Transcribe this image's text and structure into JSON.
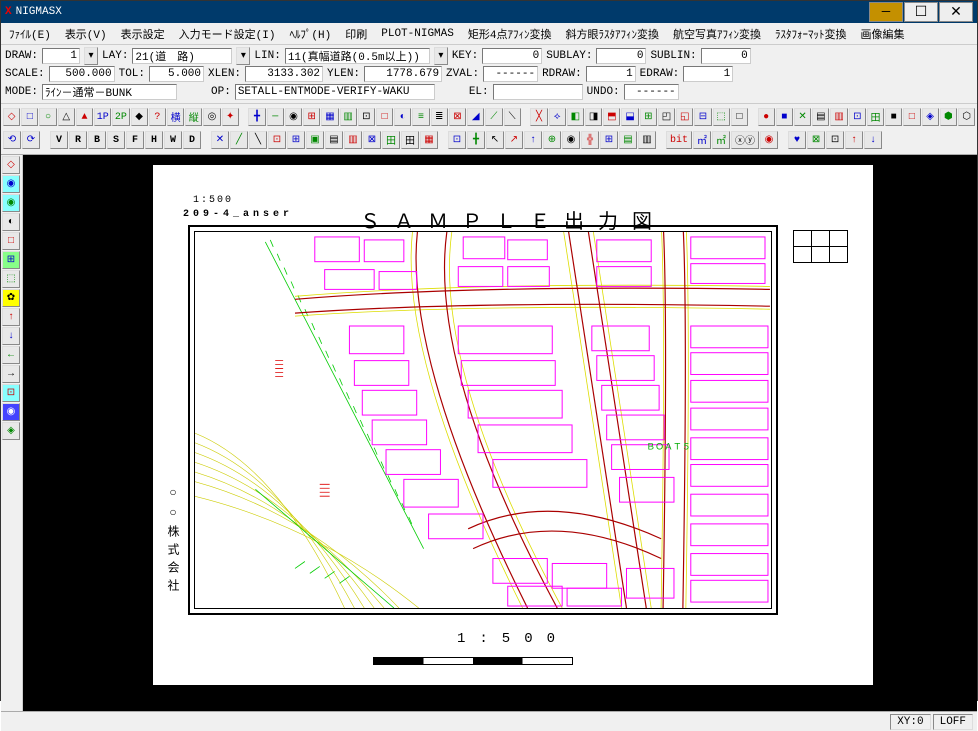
{
  "window": {
    "app_icon": "X",
    "title": "NIGMASX"
  },
  "menu": [
    "ﾌｧｲﾙ(E)",
    "表示(V)",
    "表示設定",
    "入力モード設定(I)",
    "ﾍﾙﾌﾟ(H)",
    "印刷",
    "PLOT-NIGMAS",
    "矩形4点ｱﾌｨﾝ変換",
    "斜方眼ﾗｽﾀｱﾌｨﾝ変換",
    "航空写真ｱﾌｨﾝ変換",
    "ﾗｽﾀﾌｫｰﾏｯﾄ変換",
    "画像編集"
  ],
  "params": {
    "row1": {
      "draw_label": "DRAW:",
      "draw": "1",
      "lay_label": "LAY:",
      "lay": "21(道　路)",
      "lin_label": "LIN:",
      "lin": "11(真幅道路(0.5m以上))",
      "key_label": "KEY:",
      "key": "0",
      "sublay_label": "SUBLAY:",
      "sublay": "0",
      "sublin_label": "SUBLIN:",
      "sublin": "0"
    },
    "row2": {
      "scale_label": "SCALE:",
      "scale": "500.000",
      "tol_label": "TOL:",
      "tol": "5.000",
      "xlen_label": "XLEN:",
      "xlen": "3133.302",
      "ylen_label": "YLEN:",
      "ylen": "1778.679",
      "zval_label": "ZVAL:",
      "zval": "------",
      "rdraw_label": "RDRAW:",
      "rdraw": "1",
      "edraw_label": "EDRAW:",
      "edraw": "1"
    },
    "row3": {
      "mode_label": "MODE:",
      "mode": "ﾗｲﾝ－通常－BUNK",
      "op_label": "OP:",
      "op": "SETALL-ENTMODE-VERIFY-WAKU",
      "el_label": "EL:",
      "el": "",
      "undo_label": "UNDO:",
      "undo": "------"
    }
  },
  "toolbar_row1": [
    "◇",
    "□",
    "○",
    "△",
    "▲",
    "1P",
    "2P",
    "◆",
    "?",
    "横",
    "縦",
    "◎",
    "✦",
    "╋",
    "─",
    "◉",
    "⊞",
    "▦",
    "▥",
    "⊡",
    "□",
    "◐",
    "≡",
    "≣",
    "⊠",
    "◢",
    "⟋",
    "⟍",
    "╳",
    "⟡",
    "◧",
    "◨",
    "⬒",
    "⬓",
    "⊞",
    "◰",
    "◱",
    "⊟",
    "⬚",
    "□",
    "●",
    "■",
    "✕",
    "▤",
    "▥",
    "⊡",
    "田",
    "■",
    "□",
    "◈",
    "⬢",
    "⬡"
  ],
  "toolbar_row2_left": [
    "⟲",
    "⟳"
  ],
  "toolbar_row2_letters": [
    "V",
    "R",
    "B",
    "S",
    "F",
    "H",
    "W",
    "D"
  ],
  "toolbar_row2_mid": [
    "✕",
    "╱",
    "╲",
    "⊡",
    "⊞",
    "▣",
    "▤",
    "▥",
    "⊠",
    "田",
    "田",
    "▦",
    "⊡",
    "╋",
    "↖",
    "↗",
    "↑",
    "⊕",
    "◉",
    "╬",
    "⊞",
    "▤",
    "▥",
    "bit",
    "㎡",
    "㎡",
    "ⓧⓨ",
    "◉",
    "♥",
    "⊠",
    "⊡",
    "↑",
    "↓"
  ],
  "side_tools": [
    "◇",
    "◉",
    "◉",
    "◐",
    "□",
    "⊞",
    "⬚",
    "✿",
    "↑",
    "↓",
    "←",
    "→",
    "⊡",
    "◉",
    "◈"
  ],
  "map": {
    "title": "ＳＡＭＰＬＥ出力図",
    "scale_top": "1:500",
    "file": "209-4_anser",
    "company": "○○株式会社",
    "scale_bottom": "1:500",
    "annotation": "ＢＯＡＴ５"
  },
  "legend": [
    [
      "",
      "",
      ""
    ],
    [
      "",
      "",
      ""
    ]
  ],
  "status": {
    "xy": "XY:0",
    "loff": "LOFF"
  }
}
